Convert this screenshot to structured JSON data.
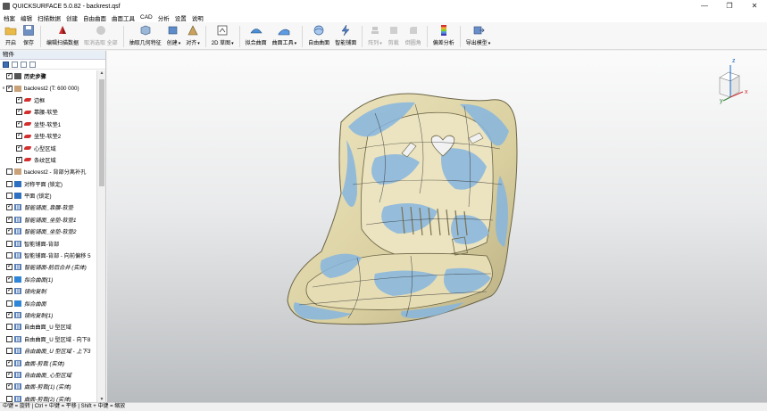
{
  "window": {
    "title": "QUICKSURFACE 5.0.82 - backrest.qsf",
    "minimize": "—",
    "maximize": "❐",
    "close": "✕"
  },
  "menu": [
    "档案",
    "编辑",
    "扫描数据",
    "创建",
    "自由曲面",
    "曲面工具",
    "CAD",
    "分析",
    "设置",
    "说明"
  ],
  "toolbar": [
    {
      "label": "开启",
      "icon": "folder-open-icon",
      "enabled": true
    },
    {
      "label": "保存",
      "icon": "save-icon",
      "enabled": true
    },
    {
      "label": "编辑扫描数据",
      "icon": "edit-mesh-icon",
      "enabled": true
    },
    {
      "label": "取消选取 全部",
      "icon": "deselect-all-icon",
      "enabled": false
    },
    {
      "label": "抽取几何特征",
      "icon": "extract-primitive-icon",
      "enabled": true
    },
    {
      "label": "创建",
      "icon": "create-icon",
      "enabled": true,
      "dropdown": true
    },
    {
      "label": "对齐",
      "icon": "align-icon",
      "enabled": true,
      "dropdown": true
    },
    {
      "label": "2D 草图",
      "icon": "sketch-2d-icon",
      "enabled": true,
      "dropdown": true
    },
    {
      "label": "拟合曲面",
      "icon": "fit-surface-icon",
      "enabled": true
    },
    {
      "label": "曲面工具",
      "icon": "surface-tools-icon",
      "enabled": true,
      "dropdown": true
    },
    {
      "label": "自由曲面",
      "icon": "freeform-icon",
      "enabled": true
    },
    {
      "label": "智能铺面",
      "icon": "smart-surface-icon",
      "enabled": true
    },
    {
      "label": "阵列",
      "icon": "pattern-icon",
      "enabled": false,
      "dropdown": true
    },
    {
      "label": "剪裁",
      "icon": "trim-icon",
      "enabled": false
    },
    {
      "label": "倒圆角",
      "icon": "fillet-icon",
      "enabled": false
    },
    {
      "label": "偏差分析",
      "icon": "deviation-analysis-icon",
      "enabled": true
    },
    {
      "label": "导出模型",
      "icon": "export-model-icon",
      "enabled": true,
      "dropdown": true
    }
  ],
  "panel": {
    "title": "物件",
    "tree": [
      {
        "label": "历史步骤",
        "checked": true,
        "level": 0,
        "expand": "",
        "icon": "history",
        "bold": true
      },
      {
        "label": "backrest2 (T: 600 000)",
        "checked": true,
        "level": 0,
        "expand": "∨",
        "icon": "mesh"
      },
      {
        "label": "边框",
        "checked": true,
        "level": 1,
        "icon": "region-red"
      },
      {
        "label": "靠腰-软垫",
        "checked": true,
        "level": 1,
        "icon": "region-red"
      },
      {
        "label": "坐垫-软垫1",
        "checked": true,
        "level": 1,
        "icon": "region-red"
      },
      {
        "label": "坐垫-软垫2",
        "checked": true,
        "level": 1,
        "icon": "region-red"
      },
      {
        "label": "心型区域",
        "checked": true,
        "level": 1,
        "icon": "region-red"
      },
      {
        "label": "条纹区域",
        "checked": true,
        "level": 1,
        "icon": "region-red"
      },
      {
        "label": "backrest2 - 背部分离补孔",
        "checked": false,
        "level": 0,
        "icon": "mesh"
      },
      {
        "label": "对称平面 (锁定)",
        "checked": false,
        "level": 0,
        "icon": "plane"
      },
      {
        "label": "平面 (锁定)",
        "checked": false,
        "level": 0,
        "icon": "plane"
      },
      {
        "label": "智能铺面_靠腰-软垫",
        "checked": true,
        "level": 0,
        "icon": "grid",
        "italic": true
      },
      {
        "label": "智能铺面_坐垫-软垫1",
        "checked": true,
        "level": 0,
        "icon": "grid",
        "italic": true
      },
      {
        "label": "智能铺面_坐垫-软垫2",
        "checked": true,
        "level": 0,
        "icon": "grid",
        "italic": true
      },
      {
        "label": "智能铺面-背部",
        "checked": false,
        "level": 0,
        "icon": "grid"
      },
      {
        "label": "智能铺面-背部 - 向前偏移 5",
        "checked": false,
        "level": 0,
        "icon": "grid"
      },
      {
        "label": "智能铺面-前后合并 (实体)",
        "checked": true,
        "level": 0,
        "icon": "grid",
        "italic": true
      },
      {
        "label": "拟合曲面(1)",
        "checked": true,
        "level": 0,
        "icon": "fit",
        "italic": true
      },
      {
        "label": "镜向复制",
        "checked": true,
        "level": 0,
        "icon": "grid",
        "italic": true
      },
      {
        "label": "拟合曲面",
        "checked": false,
        "level": 0,
        "icon": "fit",
        "italic": true
      },
      {
        "label": "镜向复制(1)",
        "checked": true,
        "level": 0,
        "icon": "grid",
        "italic": true
      },
      {
        "label": "自由曲面_U 型区域",
        "checked": false,
        "level": 0,
        "icon": "grid"
      },
      {
        "label": "自由曲面_U 型区域 - 向下8",
        "checked": false,
        "level": 0,
        "icon": "grid"
      },
      {
        "label": "自由曲面_U 型区域 - 上下3",
        "checked": false,
        "level": 0,
        "icon": "grid",
        "italic": true
      },
      {
        "label": "曲面-剪裁 (实体)",
        "checked": true,
        "level": 0,
        "icon": "grid",
        "italic": true
      },
      {
        "label": "自由曲面_心型区域",
        "checked": true,
        "level": 0,
        "icon": "grid",
        "italic": true
      },
      {
        "label": "曲面-剪裁(1) (实体)",
        "checked": true,
        "level": 0,
        "icon": "grid",
        "italic": true
      },
      {
        "label": "曲面-剪裁(2) (实体)",
        "checked": false,
        "level": 0,
        "icon": "grid",
        "italic": true
      }
    ]
  },
  "viewcube": {
    "axis_x": "x",
    "axis_y": "y",
    "axis_z": "z"
  },
  "status": "中键 = 旋转 | Ctrl + 中键 = 平移 | Shift + 中键 = 缩放",
  "colors": {
    "surface": "#e2d9ad",
    "deviation": "#86b6df",
    "background_top": "#fbfbfb",
    "background_bottom": "#b9bcbf"
  }
}
